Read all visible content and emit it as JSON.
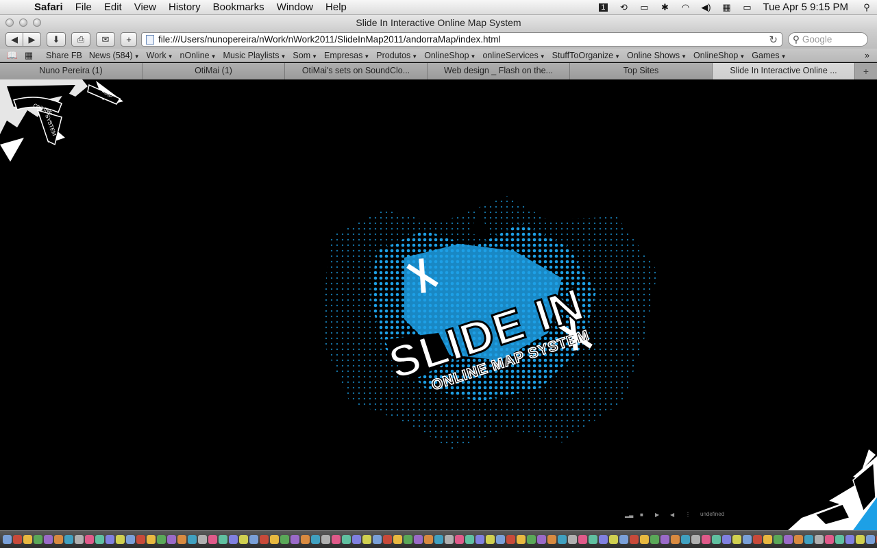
{
  "menubar": {
    "app_name": "Safari",
    "items": [
      "File",
      "Edit",
      "View",
      "History",
      "Bookmarks",
      "Window",
      "Help"
    ],
    "clock": "Tue Apr 5  9:15 PM",
    "status_icons": [
      "one-password-icon",
      "time-machine-icon",
      "display-icon",
      "bluetooth-icon",
      "wifi-icon",
      "volume-icon",
      "calendar-icon",
      "battery-icon"
    ]
  },
  "window": {
    "title": "Slide In Interactive Online Map System"
  },
  "toolbar": {
    "back_label": "◀",
    "forward_label": "▶",
    "download_label": "⬇",
    "print_label": "⎙",
    "mail_label": "✉",
    "add_label": "+",
    "url": "file:///Users/nunopereira/nWork/nWork2011/SlideInMap2011/andorraMap/index.html",
    "reload_label": "↻",
    "search_placeholder": "Google"
  },
  "bookmarks": {
    "items": [
      {
        "label": "Share FB",
        "menu": false
      },
      {
        "label": "News (584)",
        "menu": true
      },
      {
        "label": "Work",
        "menu": true
      },
      {
        "label": "nOnline",
        "menu": true
      },
      {
        "label": "Music Playlists",
        "menu": true
      },
      {
        "label": "Som",
        "menu": true
      },
      {
        "label": "Empresas",
        "menu": true
      },
      {
        "label": "Produtos",
        "menu": true
      },
      {
        "label": "OnlineShop",
        "menu": true
      },
      {
        "label": "onlineServices",
        "menu": true
      },
      {
        "label": "StuffToOrganize",
        "menu": true
      },
      {
        "label": "Online Shows",
        "menu": true
      },
      {
        "label": "OnlineShop",
        "menu": true
      },
      {
        "label": "Games",
        "menu": true
      }
    ],
    "overflow": "»"
  },
  "tabs": [
    {
      "label": "Nuno Pereira (1)",
      "active": false
    },
    {
      "label": "OtiMai (1)",
      "active": false
    },
    {
      "label": "OtiMai's sets on SoundClo...",
      "active": false
    },
    {
      "label": "Web design _ Flash on the...",
      "active": false
    },
    {
      "label": "Top Sites",
      "active": false
    },
    {
      "label": "Slide In Interactive Online ...",
      "active": true
    }
  ],
  "page": {
    "logo_line1": "SLIDE IN",
    "logo_line2": "ONLINE MAP SYSTEM",
    "corner_labels": [
      "ONLINE",
      "MAP",
      "SYSTEM"
    ],
    "player_status": "undefined",
    "accent_color": "#1da0e6"
  }
}
